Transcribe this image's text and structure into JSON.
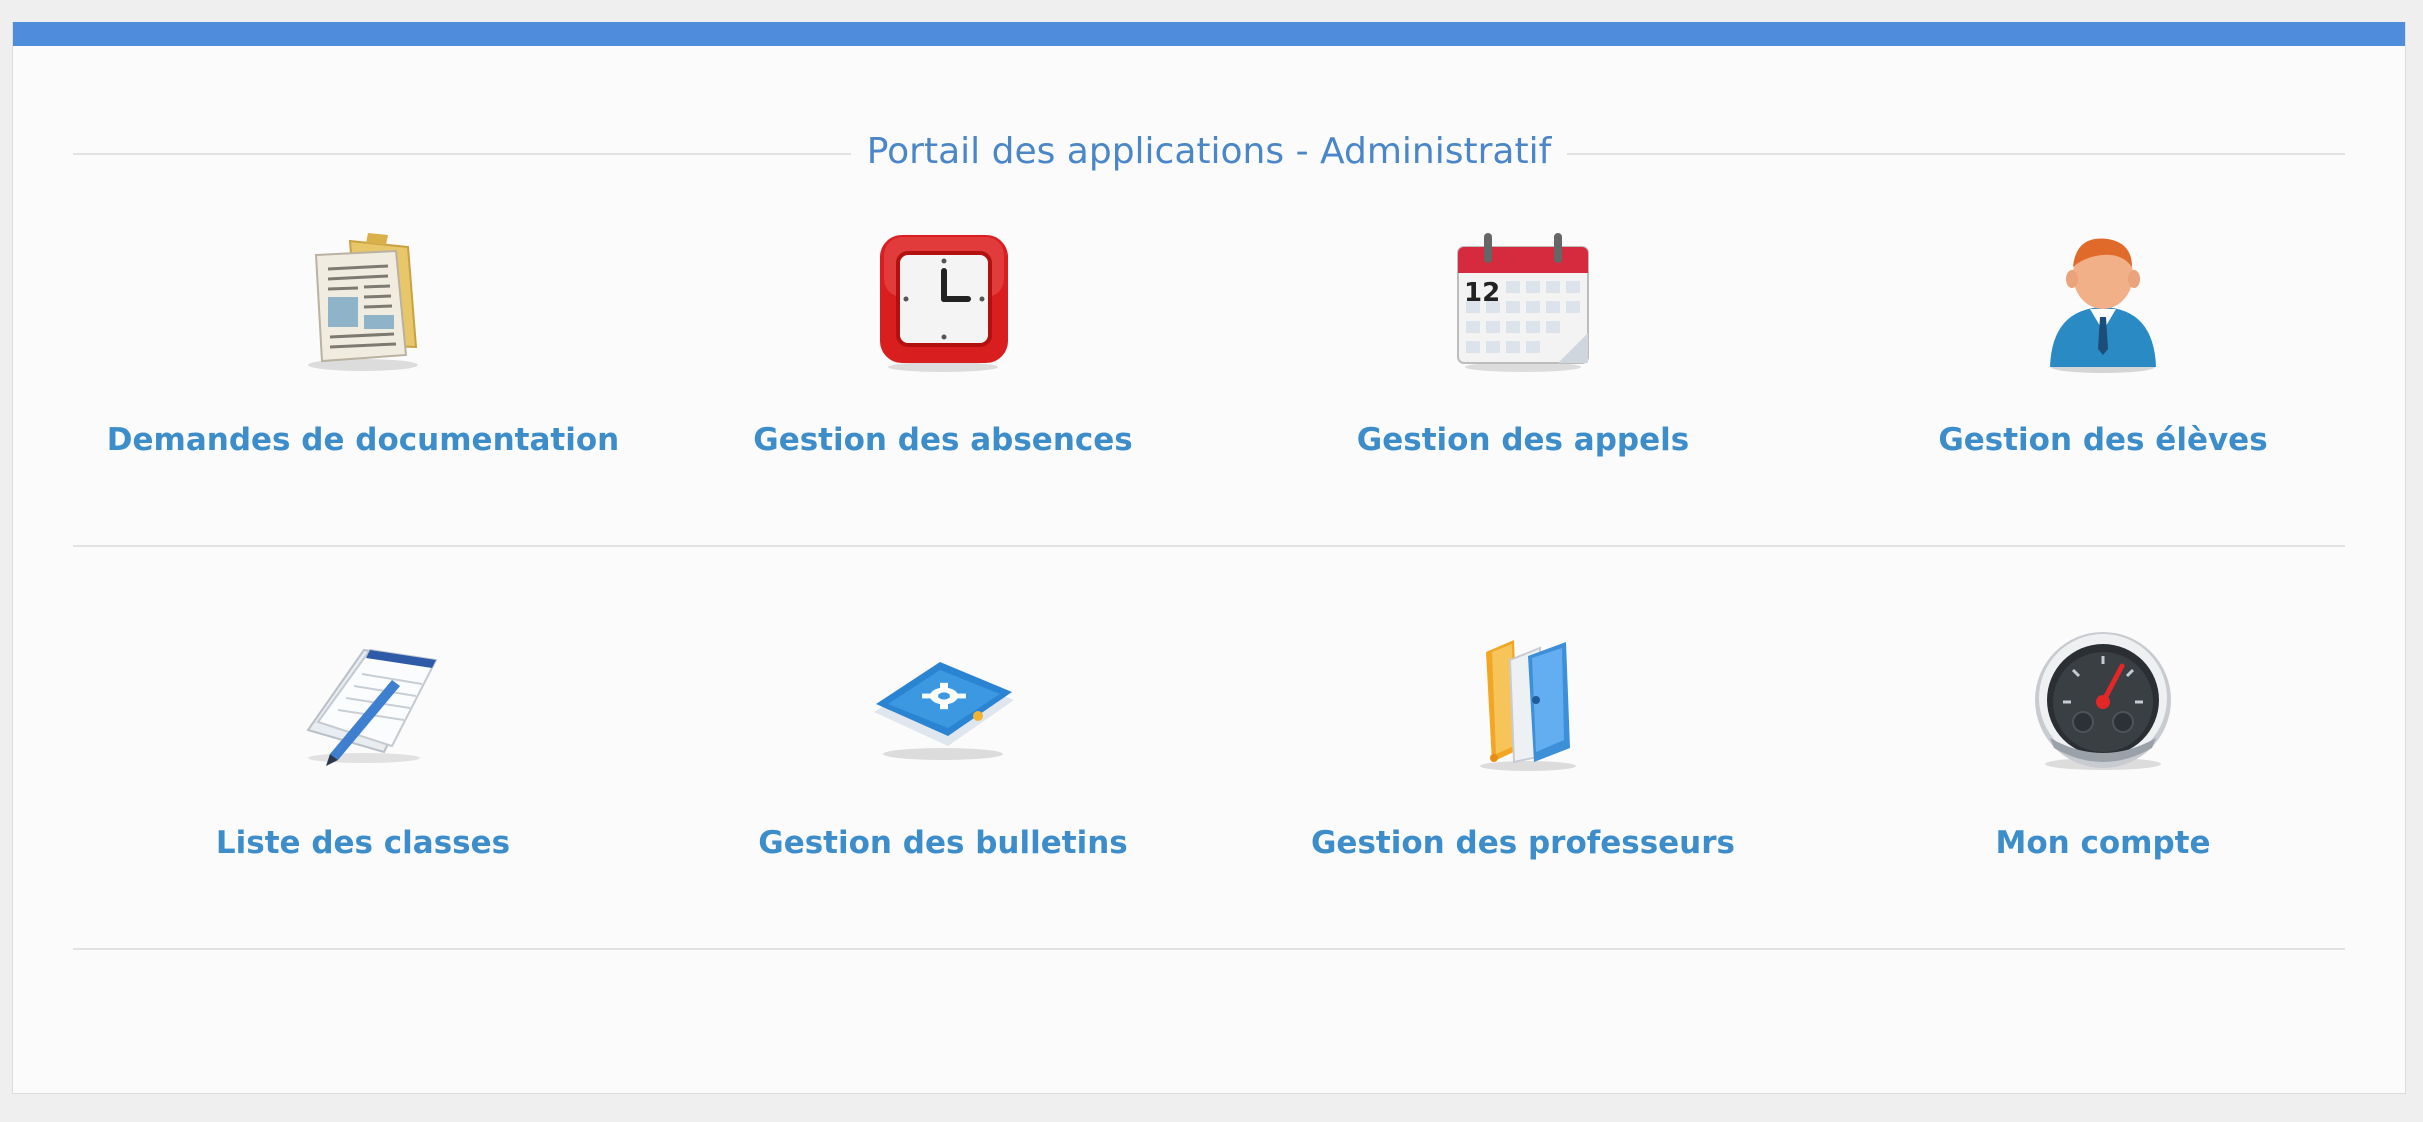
{
  "portal": {
    "title": "Portail des applications - Administratif"
  },
  "apps": {
    "row1": [
      {
        "label": "Demandes de documentation",
        "icon": "documents-icon"
      },
      {
        "label": "Gestion des absences",
        "icon": "clock-icon"
      },
      {
        "label": "Gestion des appels",
        "icon": "calendar-icon",
        "calendar_day": "12"
      },
      {
        "label": "Gestion des élèves",
        "icon": "student-icon"
      }
    ],
    "row2": [
      {
        "label": "Liste des classes",
        "icon": "notepad-icon"
      },
      {
        "label": "Gestion des bulletins",
        "icon": "settings-panel-icon"
      },
      {
        "label": "Gestion des professeurs",
        "icon": "folders-icon"
      },
      {
        "label": "Mon compte",
        "icon": "dashboard-gauge-icon"
      }
    ]
  },
  "colors": {
    "accent_bar": "#4f8cdc",
    "title": "#4a86c8",
    "link": "#3c8dc9"
  }
}
